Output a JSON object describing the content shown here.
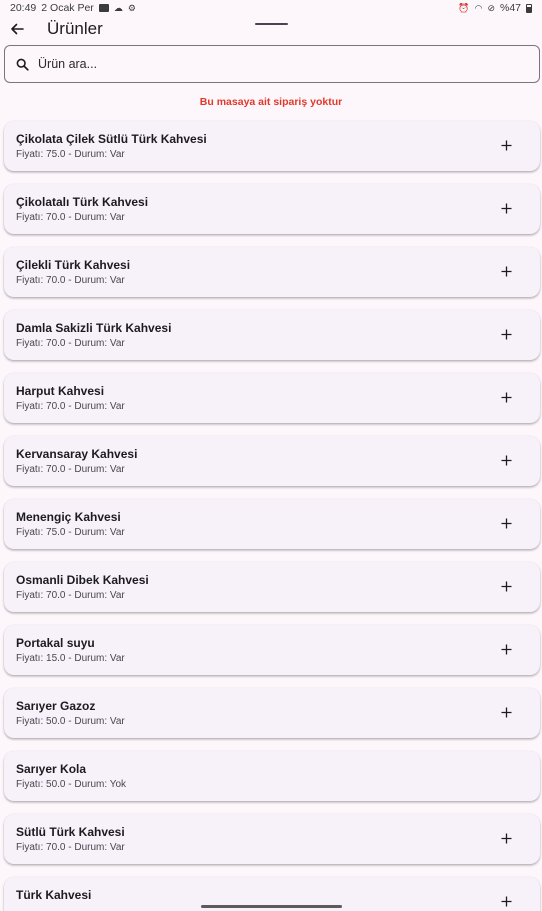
{
  "status_bar": {
    "time": "20:49",
    "date": "2 Ocak Per",
    "battery": "%47"
  },
  "header": {
    "title": "Ürünler"
  },
  "search": {
    "placeholder": "Ürün ara..."
  },
  "message": "Bu masaya ait sipariş yoktur",
  "colors": {
    "background": "#fdf7fb",
    "card": "#f7f2fa",
    "message": "#e0392b"
  },
  "products": [
    {
      "name": "Çikolata Çilek Sütlü Türk Kahvesi",
      "meta": "Fiyatı: 75.0 - Durum: Var",
      "addable": true
    },
    {
      "name": "Çikolatalı Türk Kahvesi",
      "meta": "Fiyatı: 70.0 - Durum: Var",
      "addable": true
    },
    {
      "name": "Çilekli Türk Kahvesi",
      "meta": "Fiyatı: 70.0 - Durum: Var",
      "addable": true
    },
    {
      "name": "Damla Sakizli Türk Kahvesi",
      "meta": "Fiyatı: 70.0 - Durum: Var",
      "addable": true
    },
    {
      "name": "Harput Kahvesi",
      "meta": "Fiyatı: 70.0 - Durum: Var",
      "addable": true
    },
    {
      "name": "Kervansaray Kahvesi",
      "meta": "Fiyatı: 70.0 - Durum: Var",
      "addable": true
    },
    {
      "name": "Menengiç Kahvesi",
      "meta": "Fiyatı: 75.0 - Durum: Var",
      "addable": true
    },
    {
      "name": "Osmanli Dibek Kahvesi",
      "meta": "Fiyatı: 70.0 - Durum: Var",
      "addable": true
    },
    {
      "name": "Portakal suyu",
      "meta": "Fiyatı: 15.0 - Durum: Var",
      "addable": true
    },
    {
      "name": "Sarıyer Gazoz",
      "meta": "Fiyatı: 50.0 - Durum: Var",
      "addable": true
    },
    {
      "name": "Sarıyer Kola",
      "meta": "Fiyatı: 50.0 - Durum: Yok",
      "addable": false
    },
    {
      "name": "Sütlü Türk Kahvesi",
      "meta": "Fiyatı: 70.0 - Durum: Var",
      "addable": true
    },
    {
      "name": "Türk Kahvesi",
      "meta": "",
      "addable": true
    }
  ]
}
